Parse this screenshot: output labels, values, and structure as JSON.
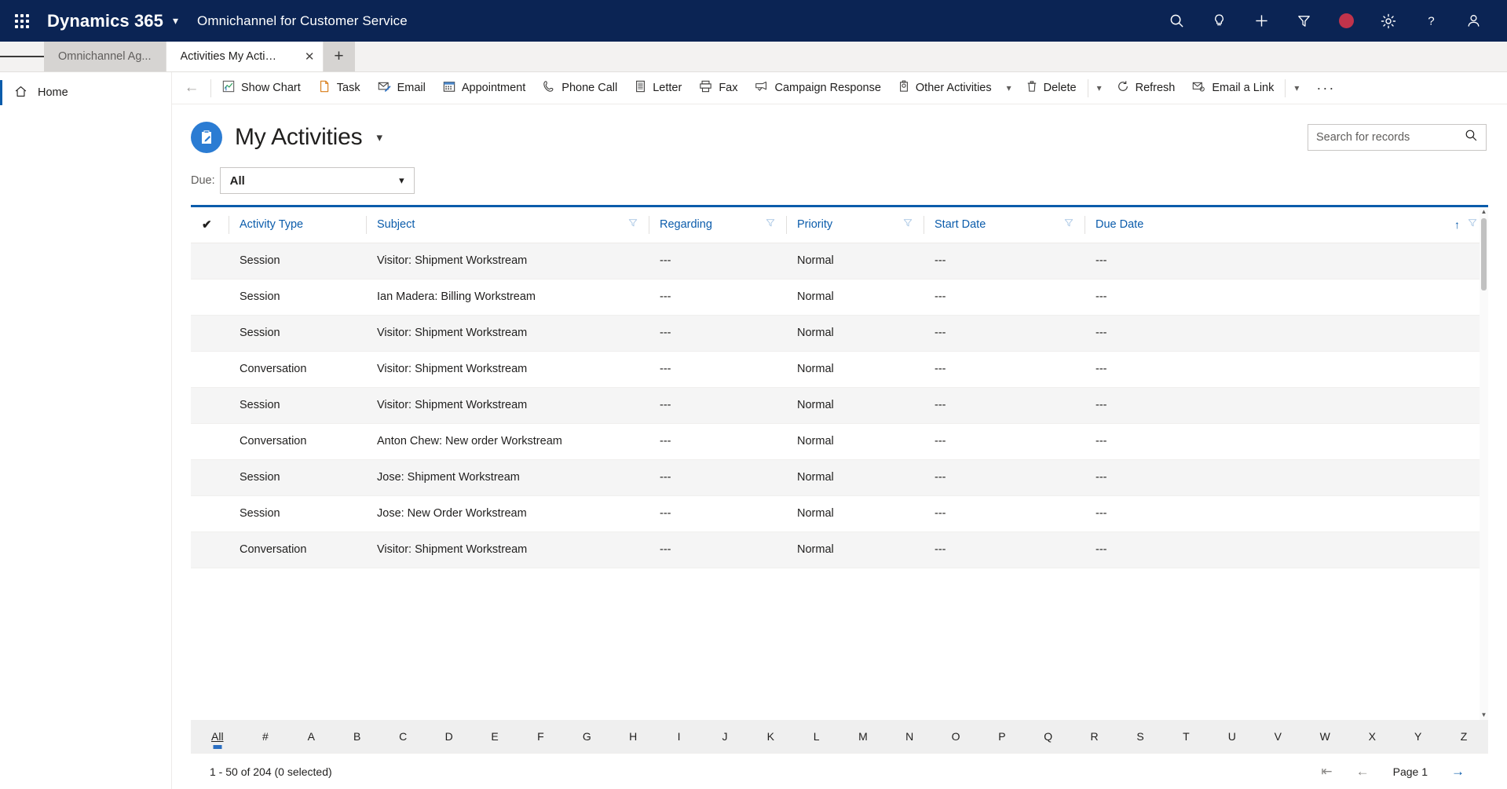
{
  "topbar": {
    "brand": "Dynamics 365",
    "app_name": "Omnichannel for Customer Service",
    "icons": [
      "search-icon",
      "lightbulb-icon",
      "plus-icon",
      "filter-icon",
      "presence-dot",
      "gear-icon",
      "help-icon",
      "account-icon"
    ],
    "accent_bg": "#0b2454",
    "presence_color": "#c0334b"
  },
  "tabs": [
    {
      "label": "Omnichannel Ag...",
      "active": false
    },
    {
      "label": "Activities My Activities",
      "active": true
    }
  ],
  "tab_add_label": "+",
  "sidenav": {
    "items": [
      {
        "label": "Home",
        "icon": "home-icon",
        "selected": true
      }
    ]
  },
  "commandbar": {
    "back": "←",
    "items": [
      {
        "label": "Show Chart",
        "icon": "chart-icon"
      },
      {
        "label": "Task",
        "icon": "task-icon"
      },
      {
        "label": "Email",
        "icon": "email-icon"
      },
      {
        "label": "Appointment",
        "icon": "calendar-icon"
      },
      {
        "label": "Phone Call",
        "icon": "phone-icon"
      },
      {
        "label": "Letter",
        "icon": "letter-icon"
      },
      {
        "label": "Fax",
        "icon": "fax-icon"
      },
      {
        "label": "Campaign Response",
        "icon": "campaign-icon"
      },
      {
        "label": "Other Activities",
        "icon": "other-activities-icon",
        "caret": true
      },
      {
        "label": "Delete",
        "icon": "trash-icon",
        "sep_after": true,
        "caret": true
      },
      {
        "label": "Refresh",
        "icon": "refresh-icon"
      },
      {
        "label": "Email a Link",
        "icon": "email-link-icon",
        "sep_after": true,
        "caret": true
      }
    ],
    "overflow": "···"
  },
  "page": {
    "title": "My Activities",
    "title_icon": "clipboard-icon",
    "title_chevron": "∨",
    "accent": "#2b7cd3"
  },
  "search": {
    "placeholder": "Search for records",
    "value": "",
    "icon": "search-icon"
  },
  "filter": {
    "label": "Due:",
    "value": "All",
    "chevron": "∨"
  },
  "grid": {
    "columns": [
      {
        "label": "Activity Type",
        "filter": false,
        "sort": false
      },
      {
        "label": "Subject",
        "filter": true,
        "sort": false
      },
      {
        "label": "Regarding",
        "filter": true,
        "sort": false
      },
      {
        "label": "Priority",
        "filter": true,
        "sort": false
      },
      {
        "label": "Start Date",
        "filter": true,
        "sort": false
      },
      {
        "label": "Due Date",
        "filter": true,
        "sort": true,
        "sort_dir": "↑"
      }
    ],
    "select_all_icon": "checkmark-icon",
    "rows": [
      {
        "activity_type": "Session",
        "subject": "Visitor: Shipment Workstream",
        "regarding": "---",
        "priority": "Normal",
        "start_date": "---",
        "due_date": "---"
      },
      {
        "activity_type": "Session",
        "subject": "Ian Madera: Billing Workstream",
        "regarding": "---",
        "priority": "Normal",
        "start_date": "---",
        "due_date": "---"
      },
      {
        "activity_type": "Session",
        "subject": "Visitor: Shipment Workstream",
        "regarding": "---",
        "priority": "Normal",
        "start_date": "---",
        "due_date": "---"
      },
      {
        "activity_type": "Conversation",
        "subject": "Visitor: Shipment Workstream",
        "regarding": "---",
        "priority": "Normal",
        "start_date": "---",
        "due_date": "---"
      },
      {
        "activity_type": "Session",
        "subject": "Visitor: Shipment Workstream",
        "regarding": "---",
        "priority": "Normal",
        "start_date": "---",
        "due_date": "---"
      },
      {
        "activity_type": "Conversation",
        "subject": "Anton Chew: New order Workstream",
        "regarding": "---",
        "priority": "Normal",
        "start_date": "---",
        "due_date": "---"
      },
      {
        "activity_type": "Session",
        "subject": "Jose: Shipment Workstream",
        "regarding": "---",
        "priority": "Normal",
        "start_date": "---",
        "due_date": "---"
      },
      {
        "activity_type": "Session",
        "subject": "Jose: New Order Workstream",
        "regarding": "---",
        "priority": "Normal",
        "start_date": "---",
        "due_date": "---"
      },
      {
        "activity_type": "Conversation",
        "subject": "Visitor: Shipment Workstream",
        "regarding": "---",
        "priority": "Normal",
        "start_date": "---",
        "due_date": "---"
      }
    ]
  },
  "alpha_index": {
    "items": [
      "All",
      "#",
      "A",
      "B",
      "C",
      "D",
      "E",
      "F",
      "G",
      "H",
      "I",
      "J",
      "K",
      "L",
      "M",
      "N",
      "O",
      "P",
      "Q",
      "R",
      "S",
      "T",
      "U",
      "V",
      "W",
      "X",
      "Y",
      "Z"
    ],
    "active": "All"
  },
  "pager": {
    "count_text": "1 - 50 of 204 (0 selected)",
    "first_icon": "⇤",
    "prev_icon": "←",
    "page_label": "Page 1",
    "next_icon": "→"
  }
}
